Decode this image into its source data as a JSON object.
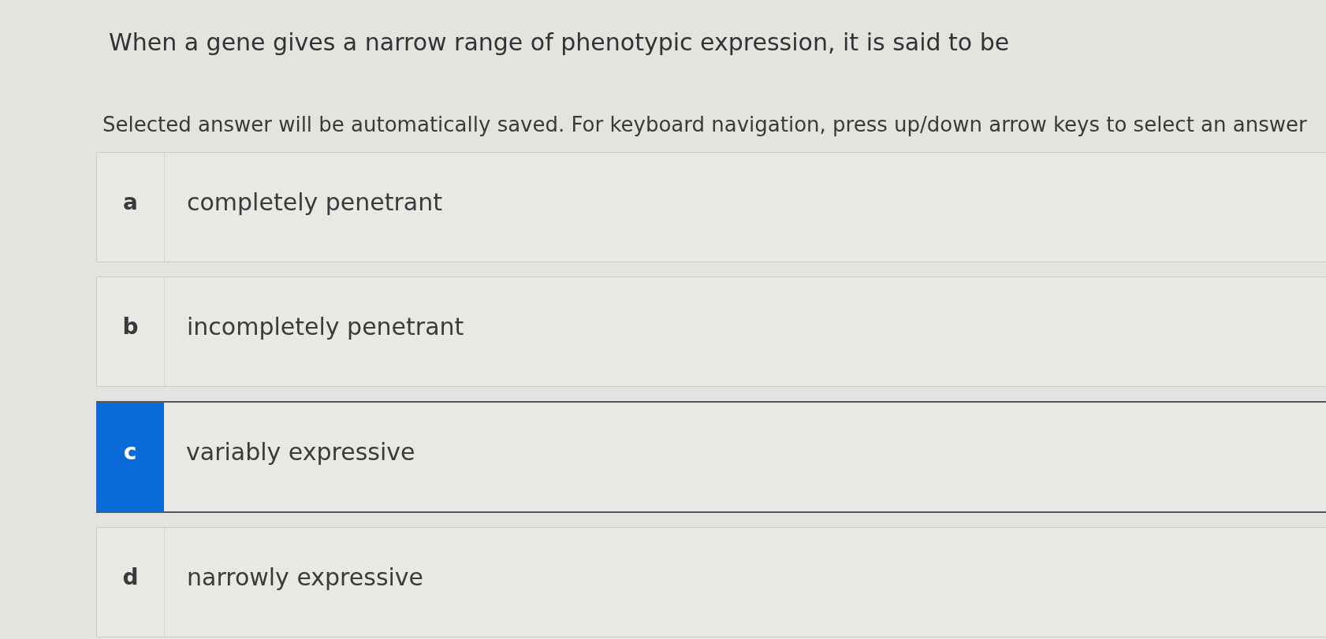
{
  "question": {
    "prompt": "When a gene gives a narrow range of phenotypic expression, it is said to be",
    "instructions": "Selected answer will be automatically saved. For keyboard navigation, press up/down arrow keys to select an answer"
  },
  "options": [
    {
      "letter": "a",
      "text": "completely penetrant",
      "selected": false
    },
    {
      "letter": "b",
      "text": "incompletely penetrant",
      "selected": false
    },
    {
      "letter": "c",
      "text": "variably expressive",
      "selected": true
    },
    {
      "letter": "d",
      "text": "narrowly expressive",
      "selected": false
    }
  ]
}
